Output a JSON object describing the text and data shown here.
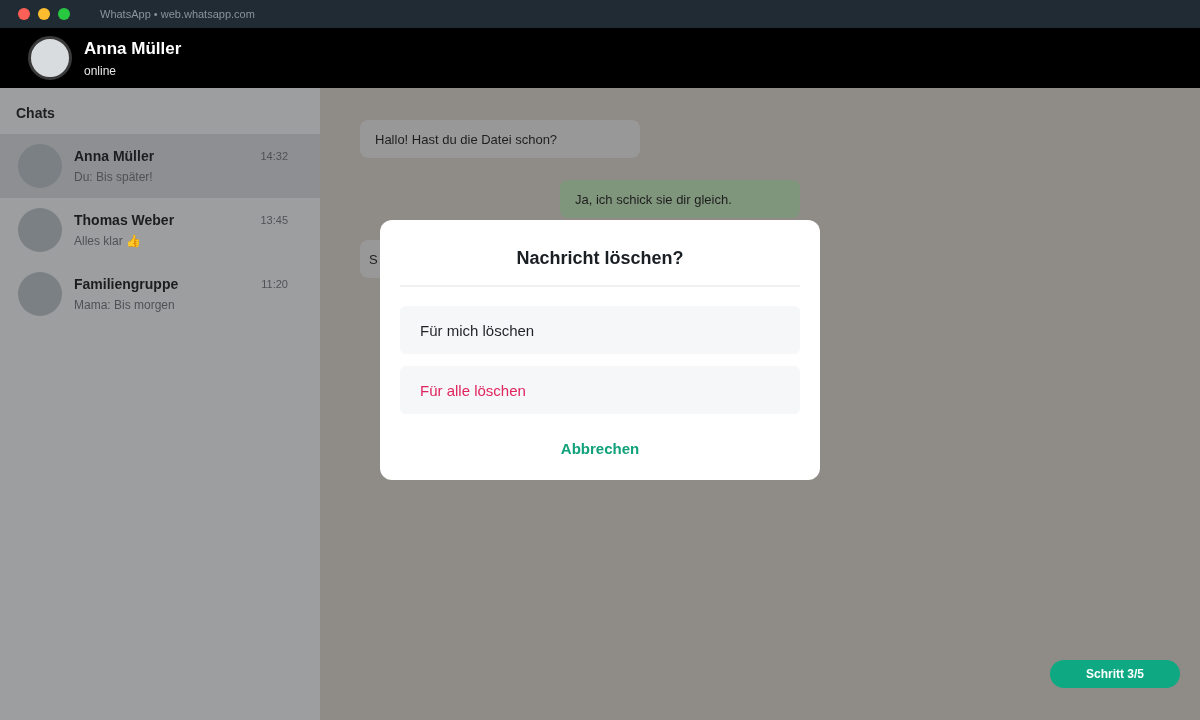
{
  "window": {
    "title": "WhatsApp • web.whatsapp.com"
  },
  "header": {
    "name": "Anna Müller",
    "status": "online"
  },
  "sidebar": {
    "title": "Chats",
    "items": [
      {
        "name": "Anna Müller",
        "preview": "Du: Bis später!",
        "time": "14:32",
        "selected": true
      },
      {
        "name": "Thomas Weber",
        "preview": "Alles klar 👍",
        "time": "13:45",
        "selected": false
      },
      {
        "name": "Familiengruppe",
        "preview": "Mama: Bis morgen",
        "time": "11:20",
        "selected": false
      }
    ]
  },
  "messages": [
    {
      "text": "Hallo! Hast du die Datei schon?",
      "kind": "incoming"
    },
    {
      "text": "Ja, ich schick sie dir gleich.",
      "kind": "outgoing"
    },
    {
      "text": "S",
      "kind": "incoming"
    }
  ],
  "dialog": {
    "title": "Nachricht löschen?",
    "options": [
      {
        "label": "Für mich löschen",
        "kind": "normal"
      },
      {
        "label": "Für alle löschen",
        "kind": "danger"
      }
    ],
    "cancel": "Abbrechen"
  },
  "step": "Schritt 3/5"
}
